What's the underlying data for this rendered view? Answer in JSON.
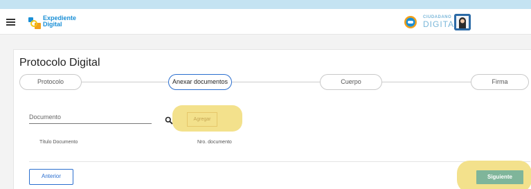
{
  "header": {
    "brand_line1": "Expediente",
    "brand_line2": "Digital",
    "cd_small": "CIUDADANO",
    "cd_big": "DIGITAL",
    "icons": [
      "menu-icon",
      "expediente-logo-icon",
      "ciudadano-digital-logo-icon",
      "user-avatar-icon"
    ]
  },
  "page": {
    "title": "Protocolo Digital"
  },
  "steps": [
    {
      "label": "Protocolo",
      "active": false
    },
    {
      "label": "Anexar documentos",
      "active": true
    },
    {
      "label": "Cuerpo",
      "active": false
    },
    {
      "label": "Firma",
      "active": false
    }
  ],
  "form": {
    "documento_label": "Documento",
    "add_button": "Agregar"
  },
  "table": {
    "columns": [
      "Título Documento",
      "Nro. documento"
    ]
  },
  "actions": {
    "previous": "Anterior",
    "next": "Siguiente"
  },
  "colors": {
    "accent": "#2a6ecf",
    "highlight": "#f2df86",
    "next_button": "#7fb59a"
  }
}
